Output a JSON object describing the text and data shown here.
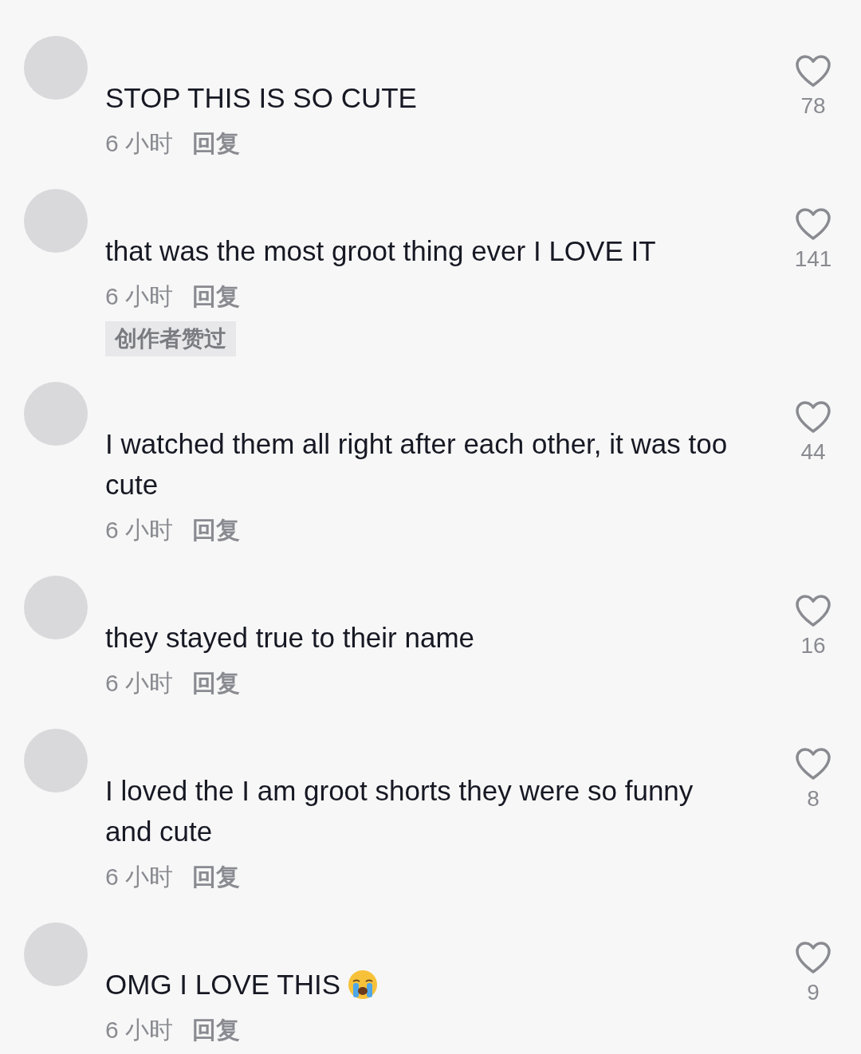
{
  "comments": [
    {
      "text": "STOP THIS IS SO CUTE",
      "time": "6 小时",
      "reply": "回复",
      "likes": "78",
      "emoji": false
    },
    {
      "text": "that was the most groot thing ever I LOVE IT",
      "time": "6 小时",
      "reply": "回复",
      "likes": "141",
      "badge": "创作者赞过",
      "emoji": false
    },
    {
      "text": "I watched them all right after each other, it was too cute",
      "time": "6 小时",
      "reply": "回复",
      "likes": "44",
      "emoji": false
    },
    {
      "text": "they stayed true to their name",
      "time": "6 小时",
      "reply": "回复",
      "likes": "16",
      "emoji": false
    },
    {
      "text": "I loved the I am groot shorts they were so funny and cute",
      "time": "6 小时",
      "reply": "回复",
      "likes": "8",
      "emoji": false
    },
    {
      "text": "OMG I LOVE THIS",
      "time": "6 小时",
      "reply": "回复",
      "likes": "9",
      "emoji": true
    }
  ]
}
